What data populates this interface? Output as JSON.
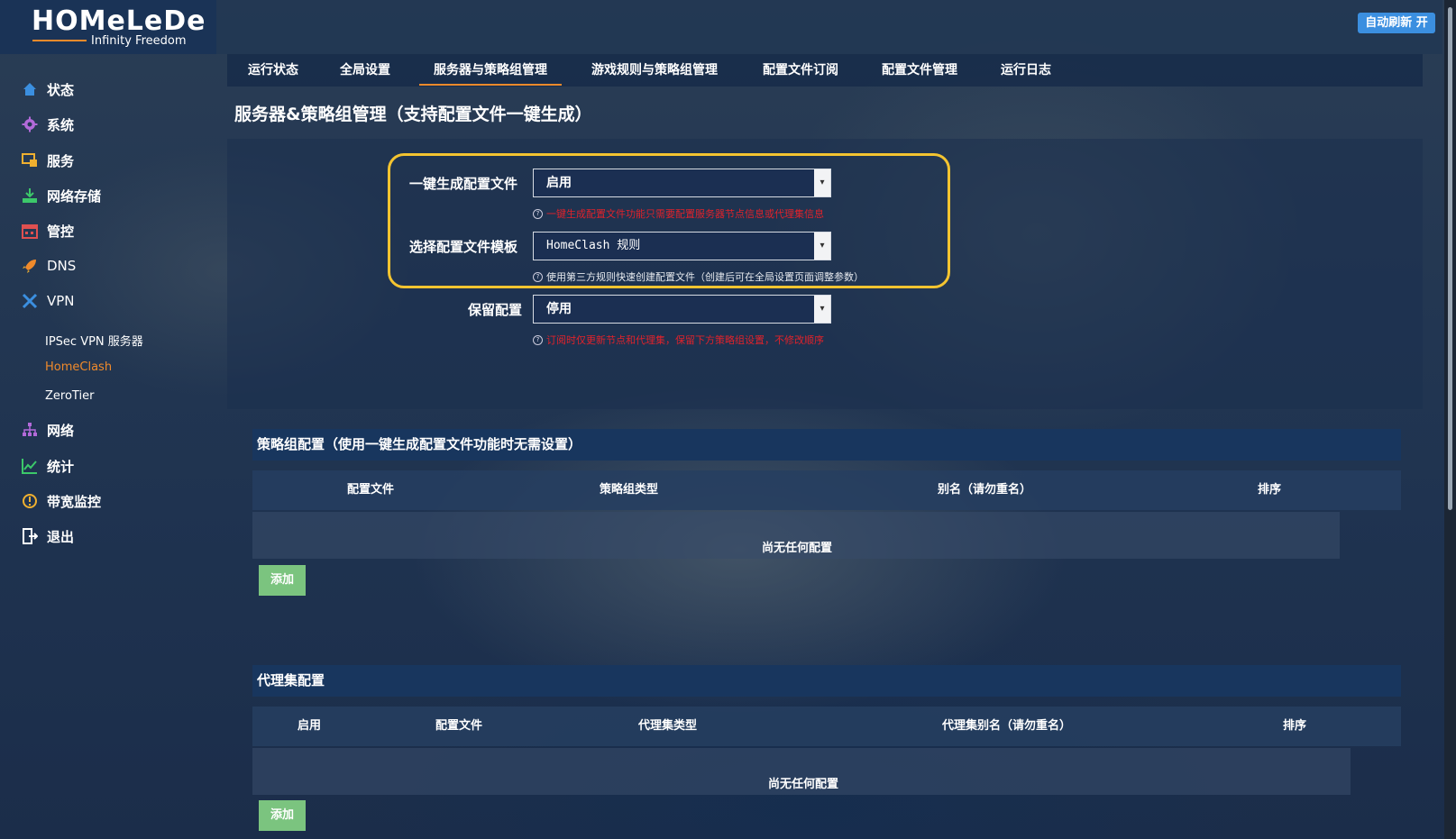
{
  "header": {
    "logo": "HOMeLeDe",
    "logo_sub": "Infinity Freedom",
    "refresh_btn": "自动刷新 开"
  },
  "sidebar": {
    "items": [
      {
        "label": "状态",
        "icon": "home-icon"
      },
      {
        "label": "系统",
        "icon": "gear-icon"
      },
      {
        "label": "服务",
        "icon": "services-icon"
      },
      {
        "label": "网络存储",
        "icon": "download-icon"
      },
      {
        "label": "管控",
        "icon": "calendar-icon"
      },
      {
        "label": "DNS",
        "icon": "rocket-icon"
      },
      {
        "label": "VPN",
        "icon": "vpn-icon"
      },
      {
        "label": "网络",
        "icon": "network-icon"
      },
      {
        "label": "统计",
        "icon": "chart-icon"
      },
      {
        "label": "带宽监控",
        "icon": "monitor-icon"
      },
      {
        "label": "退出",
        "icon": "logout-icon"
      }
    ],
    "vpn_sub": [
      {
        "label": "IPSec VPN 服务器"
      },
      {
        "label": "HomeClash"
      },
      {
        "label": "ZeroTier"
      }
    ]
  },
  "tabs": [
    {
      "label": "运行状态"
    },
    {
      "label": "全局设置"
    },
    {
      "label": "服务器与策略组管理"
    },
    {
      "label": "游戏规则与策略组管理"
    },
    {
      "label": "配置文件订阅"
    },
    {
      "label": "配置文件管理"
    },
    {
      "label": "运行日志"
    }
  ],
  "page_title": "服务器&策略组管理（支持配置文件一键生成）",
  "form": {
    "gen_label": "一键生成配置文件",
    "gen_value": "启用",
    "gen_hint": "一键生成配置文件功能只需要配置服务器节点信息或代理集信息",
    "tpl_label": "选择配置文件模板",
    "tpl_value": "HomeClash 规则",
    "tpl_hint": "使用第三方规则快速创建配置文件（创建后可在全局设置页面调整参数）",
    "keep_label": "保留配置",
    "keep_value": "停用",
    "keep_hint": "订阅时仅更新节点和代理集，保留下方策略组设置，不修改顺序"
  },
  "policy": {
    "title": "策略组配置（使用一键生成配置文件功能时无需设置）",
    "headers": [
      "配置文件",
      "策略组类型",
      "别名（请勿重名）",
      "排序"
    ],
    "empty": "尚无任何配置",
    "add": "添加"
  },
  "proxy": {
    "title": "代理集配置",
    "headers": [
      "启用",
      "配置文件",
      "代理集类型",
      "代理集别名（请勿重名）",
      "排序"
    ],
    "empty": "尚无任何配置",
    "add": "添加"
  },
  "colors": {
    "accent": "#f08a2b",
    "highlight": "#f4c430",
    "hint_red": "#e0222b",
    "button_green": "#7bc47f",
    "refresh_blue": "#3b8fe0"
  }
}
